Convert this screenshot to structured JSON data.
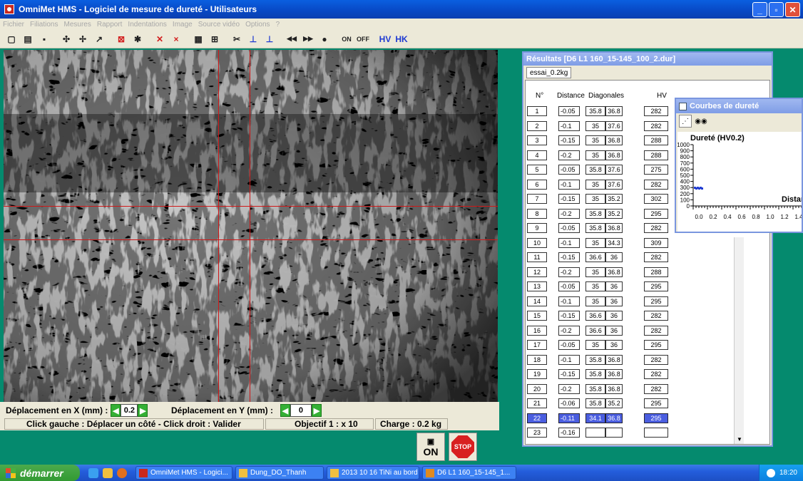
{
  "window": {
    "title": "OmniMet HMS - Logiciel de mesure de dureté - Utilisateurs",
    "min": "_",
    "max": "▫",
    "close": "✕"
  },
  "menu": [
    "Fichier",
    "Filiations",
    "Mesures",
    "Rapport",
    "Indentations",
    "Image",
    "Source vidéo",
    "Options",
    "?"
  ],
  "toolbar": {
    "icons": [
      {
        "name": "new-file-icon",
        "glyph": "▢",
        "color": "normal"
      },
      {
        "name": "open-folder-icon",
        "glyph": "▤",
        "color": "normal"
      },
      {
        "name": "save-icon",
        "glyph": "▪",
        "color": "normal"
      },
      {
        "name": "add-point-icon",
        "glyph": "✣",
        "color": "normal"
      },
      {
        "name": "add-line-icon",
        "glyph": "✢",
        "color": "normal"
      },
      {
        "name": "add-p-icon",
        "glyph": "↗",
        "color": "normal"
      },
      {
        "name": "indent-select-icon",
        "glyph": "⊠",
        "color": "red"
      },
      {
        "name": "indent-star-icon",
        "glyph": "✱",
        "color": "normal"
      },
      {
        "name": "delete-all-icon",
        "glyph": "✕",
        "color": "red"
      },
      {
        "name": "delete-icon",
        "glyph": "×",
        "color": "red"
      },
      {
        "name": "calculator-icon",
        "glyph": "▦",
        "color": "normal"
      },
      {
        "name": "grid-icon",
        "glyph": "⊞",
        "color": "normal"
      },
      {
        "name": "cut-icon",
        "glyph": "✂",
        "color": "normal"
      },
      {
        "name": "measure-icon",
        "glyph": "⊥",
        "color": "blue"
      },
      {
        "name": "measure-plus-icon",
        "glyph": "⊥",
        "color": "blue"
      },
      {
        "name": "previous-icon",
        "glyph": "◀◀",
        "color": "small"
      },
      {
        "name": "next-icon",
        "glyph": "▶▶",
        "color": "small"
      },
      {
        "name": "light-bulb-icon",
        "glyph": "●",
        "color": "normal"
      },
      {
        "name": "camera-on-icon",
        "glyph": "ON",
        "color": "small"
      },
      {
        "name": "camera-off-icon",
        "glyph": "OFF",
        "color": "small"
      },
      {
        "name": "hv-icon",
        "glyph": "HV",
        "color": "blue"
      },
      {
        "name": "hk-icon",
        "glyph": "HK",
        "color": "blue"
      }
    ]
  },
  "controls": {
    "dx_label": "Déplacement en X (mm) :",
    "dx_value": "0.2",
    "dy_label": "Déplacement en Y (mm) :",
    "dy_value": "0",
    "status_click": "Click gauche : Déplacer un côté - Click droit : Valider",
    "status_objective": "Objectif 1 : x 10",
    "status_charge": "Charge : 0.2 kg",
    "on_label": "ON",
    "stop_label": "STOP"
  },
  "results": {
    "title": "Résultats [D6 L1 160_15-145_100_2.dur]",
    "tab": "essai_0.2kg",
    "headers": {
      "n": "N°",
      "distance": "Distance",
      "diagonales": "Diagonales",
      "hv": "HV"
    },
    "rows": [
      {
        "n": "1",
        "dist": "-0.05",
        "d1": "35.8",
        "d2": "36.8",
        "hv": "282"
      },
      {
        "n": "2",
        "dist": "-0.1",
        "d1": "35",
        "d2": "37.6",
        "hv": "282"
      },
      {
        "n": "3",
        "dist": "-0.15",
        "d1": "35",
        "d2": "36.8",
        "hv": "288"
      },
      {
        "n": "4",
        "dist": "-0.2",
        "d1": "35",
        "d2": "36.8",
        "hv": "288"
      },
      {
        "n": "5",
        "dist": "-0.05",
        "d1": "35.8",
        "d2": "37.6",
        "hv": "275"
      },
      {
        "n": "6",
        "dist": "-0.1",
        "d1": "35",
        "d2": "37.6",
        "hv": "282"
      },
      {
        "n": "7",
        "dist": "-0.15",
        "d1": "35",
        "d2": "35.2",
        "hv": "302"
      },
      {
        "n": "8",
        "dist": "-0.2",
        "d1": "35.8",
        "d2": "35.2",
        "hv": "295"
      },
      {
        "n": "9",
        "dist": "-0.05",
        "d1": "35.8",
        "d2": "36.8",
        "hv": "282"
      },
      {
        "n": "10",
        "dist": "-0.1",
        "d1": "35",
        "d2": "34.3",
        "hv": "309"
      },
      {
        "n": "11",
        "dist": "-0.15",
        "d1": "36.6",
        "d2": "36",
        "hv": "282"
      },
      {
        "n": "12",
        "dist": "-0.2",
        "d1": "35",
        "d2": "36.8",
        "hv": "288"
      },
      {
        "n": "13",
        "dist": "-0.05",
        "d1": "35",
        "d2": "36",
        "hv": "295"
      },
      {
        "n": "14",
        "dist": "-0.1",
        "d1": "35",
        "d2": "36",
        "hv": "295"
      },
      {
        "n": "15",
        "dist": "-0.15",
        "d1": "36.6",
        "d2": "36",
        "hv": "282"
      },
      {
        "n": "16",
        "dist": "-0.2",
        "d1": "36.6",
        "d2": "36",
        "hv": "282"
      },
      {
        "n": "17",
        "dist": "-0.05",
        "d1": "35",
        "d2": "36",
        "hv": "295"
      },
      {
        "n": "18",
        "dist": "-0.1",
        "d1": "35.8",
        "d2": "36.8",
        "hv": "282"
      },
      {
        "n": "19",
        "dist": "-0.15",
        "d1": "35.8",
        "d2": "36.8",
        "hv": "282"
      },
      {
        "n": "20",
        "dist": "-0.2",
        "d1": "35.8",
        "d2": "36.8",
        "hv": "282"
      },
      {
        "n": "21",
        "dist": "-0.06",
        "d1": "35.8",
        "d2": "35.2",
        "hv": "295"
      },
      {
        "n": "22",
        "dist": "-0.11",
        "d1": "34.1",
        "d2": "36.8",
        "hv": "295",
        "selected": true
      },
      {
        "n": "23",
        "dist": "-0.16",
        "d1": "",
        "d2": "",
        "hv": ""
      }
    ]
  },
  "curves": {
    "title": "Courbes de dureté",
    "ylabel": "Dureté (HV0.2)",
    "xlabel": "Distar",
    "yticks": [
      "1000",
      "900",
      "800",
      "700",
      "600",
      "500",
      "400",
      "300",
      "200",
      "100",
      "0"
    ],
    "xticks": [
      "0.0",
      "0.2",
      "0.4",
      "0.6",
      "0.8",
      "1.0",
      "1.2",
      "1.4"
    ]
  },
  "taskbar": {
    "start": "démarrer",
    "tasks": [
      {
        "label": "OmniMet HMS - Logici...",
        "color": "#c8281e"
      },
      {
        "label": "Dung_DO_Thanh",
        "color": "#f0c040"
      },
      {
        "label": "2013 10 16 TiNi au bord",
        "color": "#f0c040"
      },
      {
        "label": "D6 L1 160_15-145_1...",
        "color": "#e08a20"
      }
    ],
    "time": "18:20"
  },
  "colors": {
    "crosshair": "#d01818",
    "desktop": "#058a6e",
    "selected_row": "#4b5ee0"
  }
}
